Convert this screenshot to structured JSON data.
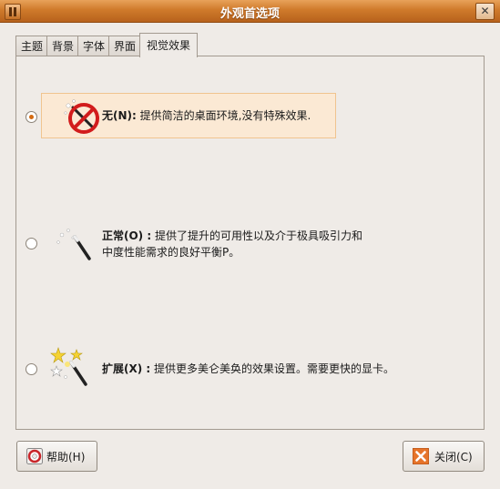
{
  "window": {
    "title": "外观首选项"
  },
  "tabs": [
    {
      "label": "主题"
    },
    {
      "label": "背景"
    },
    {
      "label": "字体"
    },
    {
      "label": "界面"
    },
    {
      "label": "视觉效果"
    }
  ],
  "active_tab": "视觉效果",
  "effects": {
    "selected": "none",
    "options": [
      {
        "id": "none",
        "title": "无(N):",
        "description": "提供简洁的桌面环境,没有特殊效果."
      },
      {
        "id": "normal",
        "title": "正常(O) :",
        "description_line1": "提供了提升的可用性以及介于极具吸引力和",
        "description_line2": "中度性能需求的良好平衡P。"
      },
      {
        "id": "extra",
        "title": "扩展(X) :",
        "description": "提供更多美仑美奂的效果设置。需要更快的显卡。"
      }
    ]
  },
  "buttons": {
    "help": "帮助(H)",
    "close": "关闭(C)"
  },
  "colors": {
    "titlebar": "#cf7a2b",
    "selected_highlight": "#fbe9d4",
    "radio_dot": "#d46b12"
  }
}
